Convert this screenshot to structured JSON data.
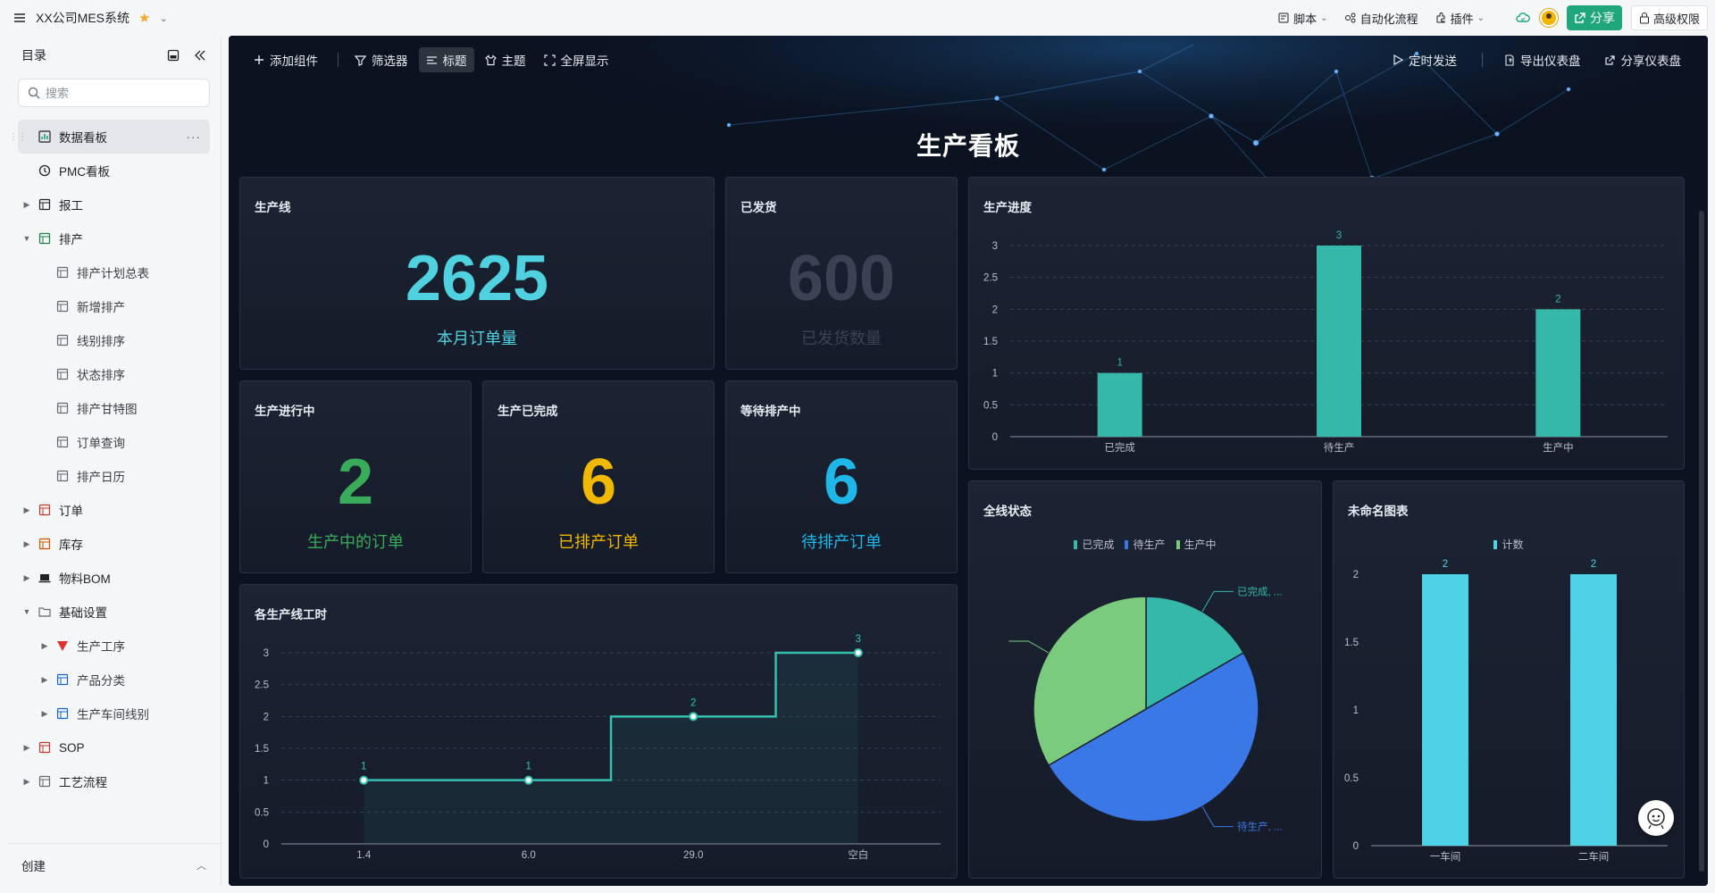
{
  "topbar": {
    "app_title": "XX公司MES系统",
    "actions": [
      {
        "label": "脚本",
        "icon": "script-icon"
      },
      {
        "label": "自动化流程",
        "icon": "automation-icon"
      },
      {
        "label": "插件",
        "icon": "plugin-icon"
      }
    ],
    "share_label": "分享",
    "permission_label": "高级权限"
  },
  "sidebar": {
    "title": "目录",
    "search_placeholder": "搜索",
    "items": [
      {
        "label": "数据看板",
        "level": 0,
        "expand": "",
        "icon": "dashboard-icon",
        "active": true
      },
      {
        "label": "PMC看板",
        "level": 0,
        "expand": "",
        "icon": "clock-icon"
      },
      {
        "label": "报工",
        "level": 0,
        "expand": "▶",
        "icon": "report-icon"
      },
      {
        "label": "排产",
        "level": 0,
        "expand": "▼",
        "icon": "schedule-icon"
      },
      {
        "label": "排产计划总表",
        "level": 1,
        "expand": "",
        "icon": "table-icon"
      },
      {
        "label": "新增排产",
        "level": 1,
        "expand": "",
        "icon": "form-icon"
      },
      {
        "label": "线别排序",
        "level": 1,
        "expand": "",
        "icon": "table-icon"
      },
      {
        "label": "状态排序",
        "level": 1,
        "expand": "",
        "icon": "table-icon"
      },
      {
        "label": "排产甘特图",
        "level": 1,
        "expand": "",
        "icon": "gantt-icon"
      },
      {
        "label": "订单查询",
        "level": 1,
        "expand": "",
        "icon": "query-icon"
      },
      {
        "label": "排产日历",
        "level": 1,
        "expand": "",
        "icon": "calendar-icon"
      },
      {
        "label": "订单",
        "level": 0,
        "expand": "▶",
        "icon": "order-icon"
      },
      {
        "label": "库存",
        "level": 0,
        "expand": "▶",
        "icon": "inventory-icon"
      },
      {
        "label": "物料BOM",
        "level": 0,
        "expand": "▶",
        "icon": "laptop-icon"
      },
      {
        "label": "基础设置",
        "level": 0,
        "expand": "▼",
        "icon": "folder-icon"
      },
      {
        "label": "生产工序",
        "level": 1,
        "expand": "▶",
        "icon": "triangle-icon"
      },
      {
        "label": "产品分类",
        "level": 1,
        "expand": "▶",
        "icon": "category-icon"
      },
      {
        "label": "生产车间线别",
        "level": 1,
        "expand": "▶",
        "icon": "grid-icon"
      },
      {
        "label": "SOP",
        "level": 0,
        "expand": "▶",
        "icon": "sop-icon"
      },
      {
        "label": "工艺流程",
        "level": 0,
        "expand": "▶",
        "icon": "process-icon"
      }
    ],
    "footer_label": "创建"
  },
  "dashboard": {
    "toolbar": [
      {
        "label": "添加组件",
        "icon": "plus-icon"
      },
      {
        "label": "筛选器",
        "icon": "filter-icon"
      },
      {
        "label": "标题",
        "icon": "title-icon",
        "active": true
      },
      {
        "label": "主题",
        "icon": "theme-icon"
      },
      {
        "label": "全屏显示",
        "icon": "fullscreen-icon"
      }
    ],
    "toolbar_right": [
      {
        "label": "定时发送",
        "icon": "send-icon"
      },
      {
        "label": "导出仪表盘",
        "icon": "export-icon"
      },
      {
        "label": "分享仪表盘",
        "icon": "share-icon"
      }
    ],
    "title": "生产看板",
    "kpis": [
      {
        "title": "生产线",
        "value": "2625",
        "label": "本月订单量",
        "color": "#4fd1e0",
        "label_color": "#4fd1e0"
      },
      {
        "title": "已发货",
        "value": "600",
        "label": "已发货数量",
        "color": "#3a4254",
        "label_color": "#3a4254"
      },
      {
        "title": "生产进行中",
        "value": "2",
        "label": "生产中的订单",
        "color": "#3aab5a",
        "label_color": "#3aab5a"
      },
      {
        "title": "生产已完成",
        "value": "6",
        "label": "已排产订单",
        "color": "#f0b800",
        "label_color": "#f0b800"
      },
      {
        "title": "等待排产中",
        "value": "6",
        "label": "待排产订单",
        "color": "#1fb6e8",
        "label_color": "#1fb6e8"
      }
    ],
    "progress_title": "生产进度",
    "hours_title": "各生产线工时",
    "status_title": "全线状态",
    "unnamed_title": "未命名图表"
  },
  "chart_data": [
    {
      "type": "bar",
      "title": "生产进度",
      "categories": [
        "已完成",
        "待生产",
        "生产中"
      ],
      "values": [
        1,
        3,
        2
      ],
      "yticks": [
        "0",
        "0.5",
        "1",
        "1.5",
        "2",
        "2.5",
        "3"
      ],
      "ylim": [
        0,
        3
      ],
      "grid": true,
      "color": "#35b7a9"
    },
    {
      "type": "line",
      "title": "各生产线工时",
      "categories": [
        "1.4",
        "6.0",
        "29.0",
        "空白"
      ],
      "values": [
        1,
        1,
        2,
        3
      ],
      "step": true,
      "yticks": [
        "0",
        "0.5",
        "1",
        "1.5",
        "2",
        "2.5",
        "3"
      ],
      "ylim": [
        0,
        3
      ],
      "grid": true,
      "color": "#35c0b0"
    },
    {
      "type": "pie",
      "title": "全线状态",
      "legend": [
        "已完成",
        "待生产",
        "生产中"
      ],
      "values": [
        1,
        3,
        2
      ],
      "colors": [
        "#35b7a9",
        "#3b78e7",
        "#7acb7e"
      ],
      "slice_labels": [
        "已完成, ...",
        "待生产, ...",
        ""
      ],
      "legend_position": "top"
    },
    {
      "type": "bar",
      "title": "未命名图表",
      "legend": [
        "计数"
      ],
      "categories": [
        "一车间",
        "二车间"
      ],
      "values": [
        2,
        2
      ],
      "yticks": [
        "0",
        "0.5",
        "1",
        "1.5",
        "2"
      ],
      "ylim": [
        0,
        2
      ],
      "grid": false,
      "color": "#4dd2e6",
      "legend_position": "top"
    }
  ]
}
